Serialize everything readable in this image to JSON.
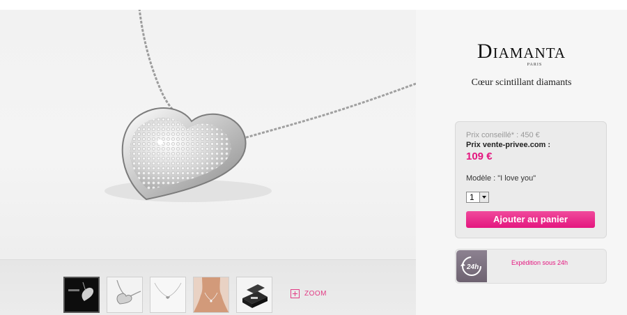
{
  "brand": {
    "name": "Diamanta",
    "sub": "PARIS"
  },
  "product": {
    "title": "Cœur scintillant diamants"
  },
  "price": {
    "old": "Prix conseillé* : 450 €",
    "label": "Prix vente-privee.com :",
    "new": "109 €"
  },
  "model": "Modèle : \"I love you\"",
  "quantity": {
    "selected": "1"
  },
  "add_to_cart": "Ajouter au panier",
  "shipping": {
    "text": "Expédition sous 24h",
    "icon_text": "24h"
  },
  "zoom": {
    "label": "ZOOM"
  },
  "thumbnails": [
    {
      "name": "thumb-box-packaging"
    },
    {
      "name": "thumb-necklace-closeup"
    },
    {
      "name": "thumb-necklace-full"
    },
    {
      "name": "thumb-worn-model"
    },
    {
      "name": "thumb-gift-box"
    }
  ],
  "colors": {
    "accent": "#e4167f",
    "panel": "#ebebeb"
  }
}
